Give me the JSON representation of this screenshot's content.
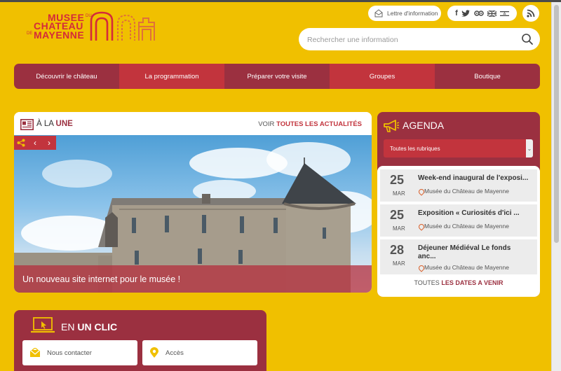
{
  "logo": {
    "line1": "MUSEE",
    "line2": "CHATEAU",
    "line3": "MAYENNE",
    "small_du": "DU",
    "small_de": "DE"
  },
  "header": {
    "newsletter_label": "Lettre d'information",
    "search_placeholder": "Rechercher une information",
    "social_icons": [
      "facebook-icon",
      "twitter-icon",
      "tripadvisor-icon",
      "uk-flag-icon",
      "israel-flag-icon"
    ],
    "rss_icon": "rss-icon"
  },
  "nav": {
    "items": [
      {
        "label": "Découvrir le château"
      },
      {
        "label": "La programmation"
      },
      {
        "label": "Préparer votre visite"
      },
      {
        "label": "Groupes"
      },
      {
        "label": "Boutique"
      }
    ]
  },
  "une": {
    "title_prefix": "À LA",
    "title_emph": "UNE",
    "all_prefix": "VOIR",
    "all_emph": "TOUTES LES ACTUALITÉS",
    "caption": "Un nouveau site internet pour le musée !",
    "controls": [
      "share-icon",
      "chevron-left-icon",
      "chevron-right-icon"
    ]
  },
  "agenda": {
    "title": "AGENDA",
    "select_value": "Toutes les rubriques",
    "events": [
      {
        "day": "25",
        "month": "MAR",
        "title": "Week-end inaugural de l'exposi...",
        "location": "Musée du Château de Mayenne"
      },
      {
        "day": "25",
        "month": "MAR",
        "title": "Exposition « Curiosités d'ici ...",
        "location": "Musée du Château de Mayenne"
      },
      {
        "day": "28",
        "month": "MAR",
        "title_line1": "Déjeuner Médiéval Le fonds",
        "title_line2": "anc...",
        "location": "Musée du Château de Mayenne"
      }
    ],
    "all_prefix": "TOUTES",
    "all_emph": "LES DATES A VENIR"
  },
  "clic": {
    "title_prefix": "EN",
    "title_emph": "UN CLIC",
    "cards": [
      {
        "label": "Nous contacter",
        "icon": "envelope-icon"
      },
      {
        "label": "Accès",
        "icon": "location-pin-icon"
      }
    ]
  },
  "colors": {
    "background": "#f0c000",
    "burgundy": "#9b3040",
    "red": "#c2343d",
    "logo_red": "#d42a3a"
  }
}
